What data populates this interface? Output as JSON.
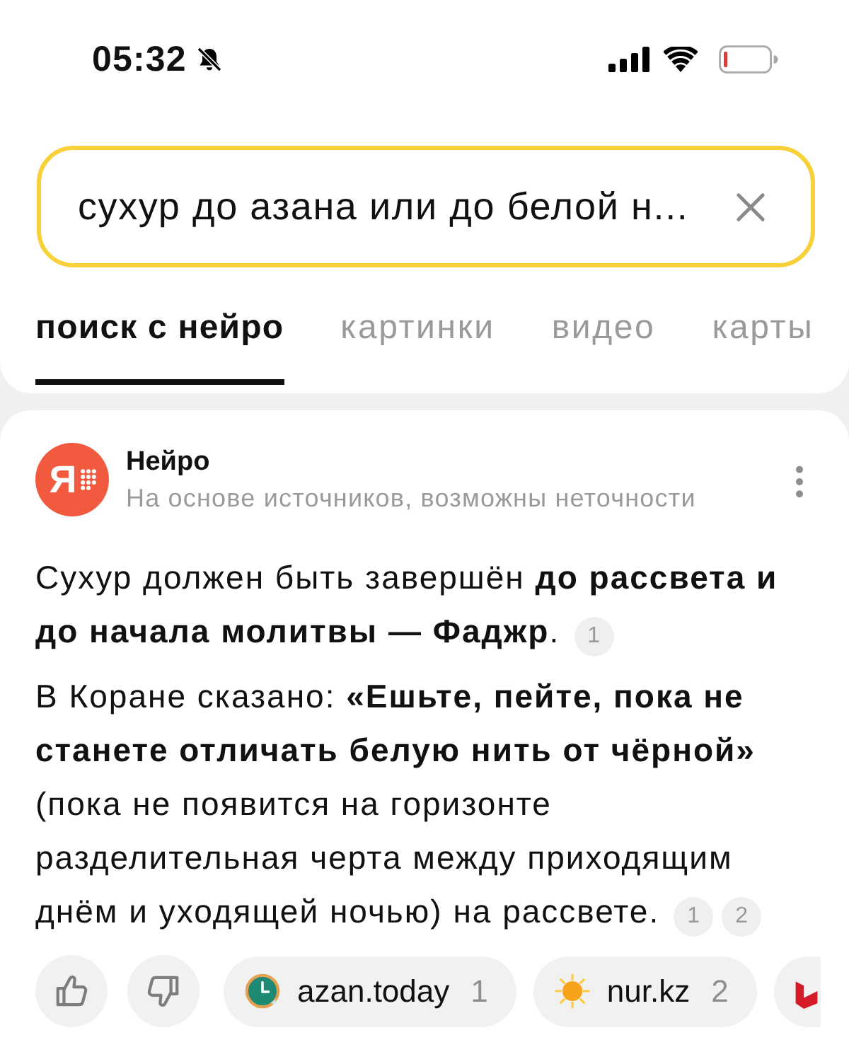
{
  "status_bar": {
    "time": "05:32",
    "silent": true,
    "battery_low": true
  },
  "search": {
    "value": "сухур до азана или до белой н..."
  },
  "tabs": [
    {
      "label": "поиск с нейро",
      "selected": true
    },
    {
      "label": "картинки",
      "selected": false
    },
    {
      "label": "видео",
      "selected": false
    },
    {
      "label": "карты",
      "selected": false
    }
  ],
  "answer": {
    "logo_letter": "Я",
    "title": "Нейро",
    "subtitle": "На основе источников, возможны неточности",
    "paragraphs": [
      {
        "text": "Сухур должен быть завершён **до рассвета и до начала молитвы — Фаджр**.",
        "citations": [
          "1"
        ]
      },
      {
        "text": "В Коране сказано: **«Ешьте, пейте, пока не станете отличать белую нить от чёрной»** (пока не появится на горизонте разделительная черта между приходящим днём и уходящей ночью) на рассвете.",
        "citations": [
          "1",
          "2"
        ]
      }
    ]
  },
  "sources": [
    {
      "kind": "clock",
      "name": "azan.today",
      "count": "1"
    },
    {
      "kind": "sun",
      "name": "nur.kz",
      "count": "2"
    },
    {
      "kind": "logo"
    }
  ]
}
